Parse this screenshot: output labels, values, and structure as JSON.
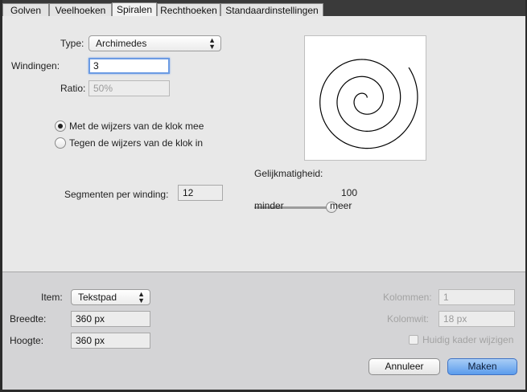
{
  "tabs": [
    {
      "label": "Golven"
    },
    {
      "label": "Veelhoeken"
    },
    {
      "label": "Spiralen"
    },
    {
      "label": "Rechthoeken"
    },
    {
      "label": "Standaardinstellingen"
    }
  ],
  "spiral": {
    "type_label": "Type:",
    "type_value": "Archimedes",
    "windings_label": "Windingen:",
    "windings_value": "3",
    "ratio_label": "Ratio:",
    "ratio_value": "50%",
    "direction_cw": "Met de wijzers van de klok mee",
    "direction_ccw": "Tegen de wijzers van de klok in",
    "segments_label": "Segmenten per winding:",
    "segments_value": "12",
    "uniformity_label": "Gelijkmatigheid:",
    "uniformity_value": "100",
    "uniformity_level": 1.0,
    "slider_min_label": "minder",
    "slider_max_label": "meer"
  },
  "lower": {
    "item_label": "Item:",
    "item_value": "Tekstpad",
    "width_label": "Breedte:",
    "width_value": "360 px",
    "height_label": "Hoogte:",
    "height_value": "360 px",
    "columns_label": "Kolommen:",
    "columns_value": "1",
    "gutter_label": "Kolomwit:",
    "gutter_value": "18 px",
    "modify_frame_label": "Huidig kader wijzigen"
  },
  "buttons": {
    "cancel": "Annuleer",
    "ok": "Maken"
  },
  "colors": {
    "focus_ring": "#6b9be3",
    "primary_button": "#5b9cec"
  }
}
